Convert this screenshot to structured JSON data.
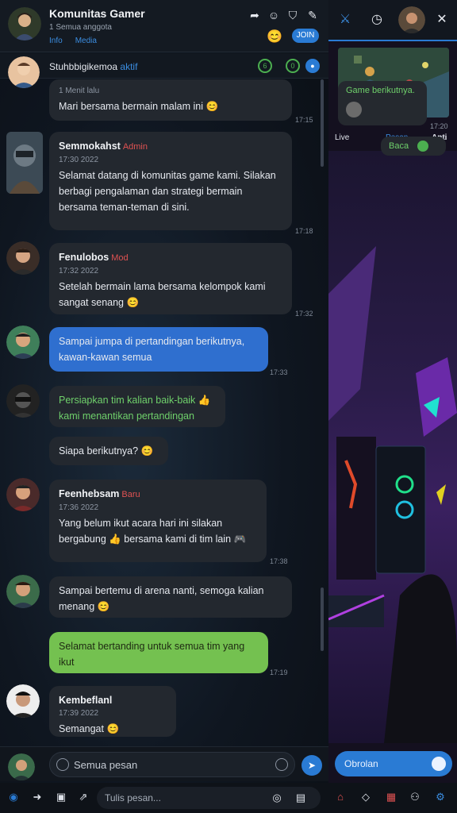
{
  "header": {
    "title": "Komunitas Gamer",
    "subtitle": "1 Semua anggota",
    "tabs": [
      "Info",
      "Media"
    ],
    "badge": "JOIN",
    "emoji": "😊"
  },
  "pinned": {
    "label": "Stuhbbigikemoa",
    "highlight": "aktif",
    "count": "6",
    "count2": "0"
  },
  "messages": [
    {
      "name": "",
      "role": "",
      "meta": "1 Menit lalu",
      "text": "Mari bersama bermain malam ini 😊",
      "time": "17:15"
    },
    {
      "name": "Semmokahst",
      "role": "Admin",
      "meta": "17:30 2022",
      "text": "Selamat datang di komunitas game kami. Silakan berbagi pengalaman dan strategi bermain bersama teman-teman di sini.",
      "time": "17:18"
    },
    {
      "name": "Fenulobos",
      "role": "Mod",
      "meta": "17:32 2022",
      "text": "Setelah bermain lama bersama kelompok kami sangat senang 😊",
      "time": "17:32"
    },
    {
      "name": "",
      "role": "",
      "meta": "",
      "text": "Sampai jumpa di pertandingan berikutnya, kawan-kawan semua",
      "time": "17:33"
    },
    {
      "name": "",
      "role": "",
      "meta": "",
      "text": "Persiapkan tim kalian baik-baik 👍 kami menantikan pertandingan",
      "time": ""
    },
    {
      "name": "",
      "role": "",
      "meta": "",
      "text": "Siapa berikutnya? 😊",
      "time": ""
    },
    {
      "name": "Feenhebsam",
      "role": "Baru",
      "meta": "17:36 2022",
      "text": "Yang belum ikut acara hari ini silakan bergabung 👍 bersama kami di tim lain 🎮",
      "time": "17:38"
    },
    {
      "name": "",
      "role": "",
      "meta": "",
      "text": "Sampai bertemu di arena nanti, semoga kalian menang 😊",
      "time": ""
    },
    {
      "name": "",
      "role": "",
      "meta": "",
      "text": "Selamat bertanding untuk semua tim yang ikut",
      "time": "17:19"
    },
    {
      "name": "Kembeflanl",
      "role": "",
      "meta": "17:39 2022",
      "text": "Semangat 😊",
      "time": ""
    }
  ],
  "composer": {
    "placeholder": "Semua pesan"
  },
  "bottom": {
    "placeholder": "Tulis pesan..."
  },
  "right": {
    "tabs": [
      "Live",
      "Pesan",
      "Anti"
    ],
    "bubble1": "Game berikutnya.",
    "bubble2": "Baca",
    "time": "17:20",
    "composer": "Obrolan"
  },
  "colors": {
    "accent": "#2a7bd4",
    "green": "#74c150",
    "bubble": "#23282f"
  }
}
